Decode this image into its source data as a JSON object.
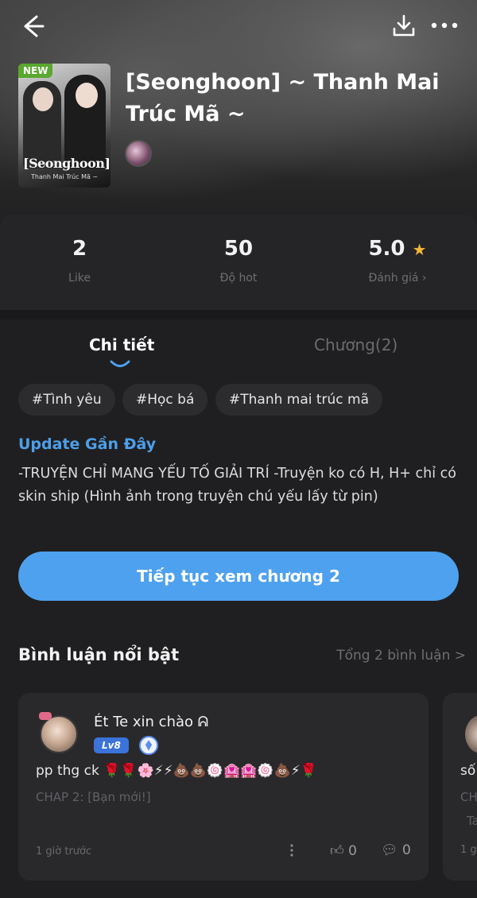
{
  "header": {
    "back_icon": "arrow-left-icon",
    "download_icon": "download-icon",
    "more_icon": "more-horizontal-icon"
  },
  "cover": {
    "badge": "NEW",
    "title": "[Seonghoon]",
    "subtitle": "Thanh Mai Trúc Mã ~"
  },
  "story": {
    "title": "[Seonghoon] ~ Thanh Mai Trúc Mã ~"
  },
  "stats": [
    {
      "value": "2",
      "label": "Like"
    },
    {
      "value": "50",
      "label": "Độ hot"
    },
    {
      "value": "5.0",
      "label": "Đánh giá ›"
    }
  ],
  "tabs": {
    "detail": "Chi tiết",
    "chapters": "Chương(2)"
  },
  "tags": [
    "#Tình yêu",
    "#Học bá",
    "#Thanh mai trúc mã"
  ],
  "update": {
    "title": "Update Gần Đây",
    "text": "-TRUYỆN CHỈ MANG YẾU TỐ GIẢI TRÍ -Truyện ko có H, H+ chỉ có skin ship (Hình ảnh trong truyện chú yếu lấy từ pin)"
  },
  "cta": {
    "label": "Tiếp tục xem chương 2"
  },
  "comments_section": {
    "title": "Bình luận nổi bật",
    "total": "Tổng 2 bình luận >"
  },
  "comments": [
    {
      "name": "Ét Te xin chào ᕱ",
      "level": "Lv8",
      "text": "pp thg ck 🌹🌹🌸⚡⚡💩💩🍥🏩🏩🍥💩⚡🌹",
      "chapter": "CHAP 2: [Bạn mới!]",
      "time": "1 giờ trước",
      "likes": "0",
      "replies": "0"
    },
    {
      "text": "số",
      "chapter": "CH",
      "chapter2": "Ta",
      "time": "1 g"
    }
  ],
  "colors": {
    "accent": "#4ea1ee",
    "update_title": "#4d9fe9",
    "star": "#f5b63a",
    "badge_new": "#5aa82f"
  }
}
